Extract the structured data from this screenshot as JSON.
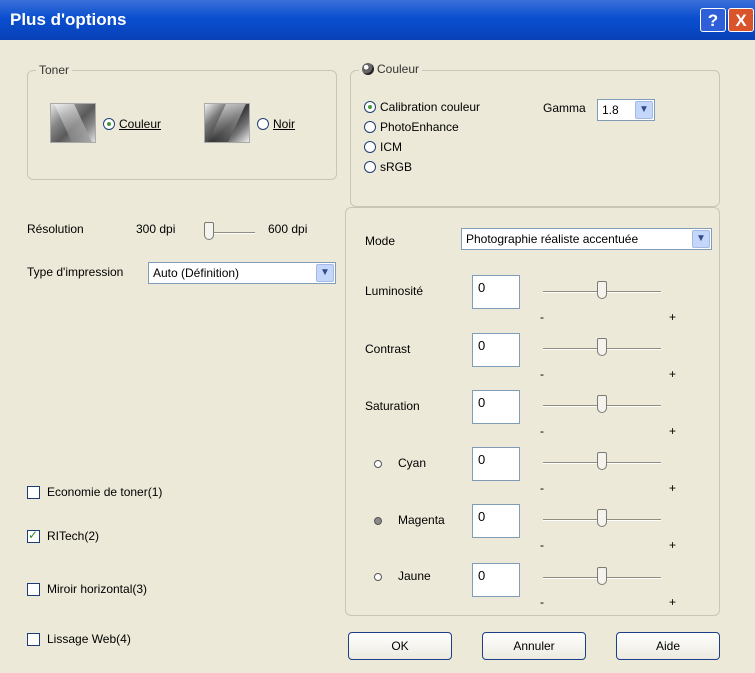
{
  "window": {
    "title": "Plus d'options",
    "help_glyph": "?",
    "close_glyph": "X"
  },
  "toner": {
    "legend": "Toner",
    "couleur_label": "Couleur",
    "noir_label": "Noir",
    "selected": "Couleur"
  },
  "couleur": {
    "legend": "Couleur",
    "options": [
      {
        "label": "Calibration couleur",
        "selected": true
      },
      {
        "label": "PhotoEnhance",
        "selected": false
      },
      {
        "label": "ICM",
        "selected": false
      },
      {
        "label": "sRGB",
        "selected": false
      }
    ],
    "gamma_label": "Gamma",
    "gamma_value": "1.8"
  },
  "resolution": {
    "label": "Résolution",
    "min_label": "300 dpi",
    "max_label": "600 dpi",
    "value": "300 dpi"
  },
  "type_impression": {
    "label": "Type d'impression",
    "value": "Auto (Définition)"
  },
  "checkboxes": [
    {
      "label": "Economie de toner(1)",
      "checked": false
    },
    {
      "label": "RITech(2)",
      "checked": true
    },
    {
      "label": "Miroir horizontal(3)",
      "checked": false
    },
    {
      "label": "Lissage Web(4)",
      "checked": false
    }
  ],
  "mode": {
    "label": "Mode",
    "value": "Photographie réaliste accentuée"
  },
  "adjustments": [
    {
      "label": "Luminosité",
      "value": "0"
    },
    {
      "label": "Contrast",
      "value": "0"
    },
    {
      "label": "Saturation",
      "value": "0"
    },
    {
      "label": "Cyan",
      "value": "0",
      "dot_color": "#ffffff"
    },
    {
      "label": "Magenta",
      "value": "0",
      "dot_color": "#8a8a8a"
    },
    {
      "label": "Jaune",
      "value": "0",
      "dot_color": "#ffffff"
    }
  ],
  "slider_min_label": "-",
  "slider_max_label": "+",
  "buttons": {
    "ok": "OK",
    "cancel": "Annuler",
    "help": "Aide"
  }
}
